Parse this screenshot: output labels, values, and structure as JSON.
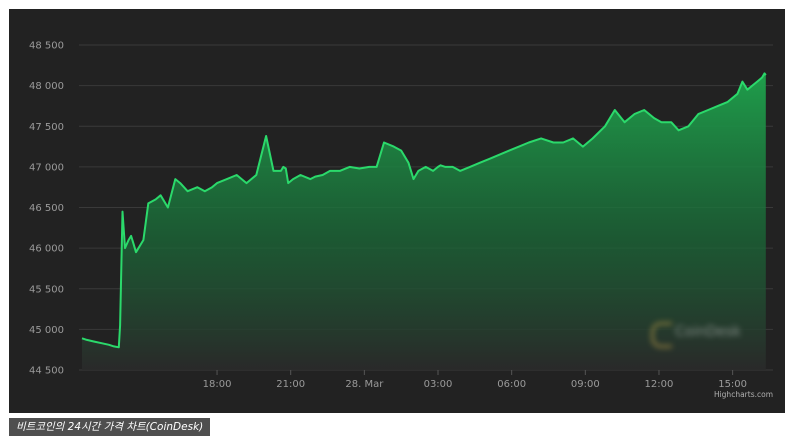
{
  "caption": "비트코인의 24시간 가격 차트(CoinDesk)",
  "credit": "Highcharts.com",
  "watermark": "CoinDesk",
  "colors": {
    "background": "#222222",
    "line": "#2bd96b",
    "area_top": "#1f9e4b",
    "area_bottom": "#2a2a2a",
    "grid": "#3a3a3a"
  },
  "chart_data": {
    "type": "area",
    "title": "",
    "xlabel": "",
    "ylabel": "",
    "ylim": [
      44500,
      48500
    ],
    "yticks": [
      "44 500",
      "45 000",
      "45 500",
      "46 000",
      "46 500",
      "47 000",
      "47 500",
      "48 000",
      "48 500"
    ],
    "ytick_values": [
      44500,
      45000,
      45500,
      46000,
      46500,
      47000,
      47500,
      48000,
      48500
    ],
    "xticks": [
      "18:00",
      "21:00",
      "28. Mar",
      "03:00",
      "06:00",
      "09:00",
      "12:00",
      "15:00"
    ],
    "xtick_hours": [
      3,
      6,
      9,
      12,
      15,
      18,
      21,
      24
    ],
    "xlim_hours": [
      -2.5,
      25.4
    ],
    "grid": true,
    "legend": "none",
    "series": [
      {
        "x": [
          -2.5,
          -2.3,
          -2.0,
          -1.7,
          -1.4,
          -1.2,
          -1.0,
          -0.95,
          -0.85,
          -0.75,
          -0.6,
          -0.5,
          -0.4,
          -0.3,
          -0.1,
          0.0,
          0.2,
          0.5,
          0.7,
          1.0,
          1.3,
          1.5,
          1.8,
          2.2,
          2.5,
          2.8,
          3.0,
          3.4,
          3.8,
          4.2,
          4.6,
          5.0,
          5.3,
          5.6,
          5.7,
          5.8,
          5.9,
          6.1,
          6.4,
          6.8,
          7.0,
          7.3,
          7.6,
          8.0,
          8.4,
          8.8,
          9.2,
          9.5,
          9.8,
          10.2,
          10.5,
          10.8,
          11.0,
          11.2,
          11.5,
          11.8,
          12.0,
          12.1,
          12.3,
          12.6,
          12.9,
          13.3,
          13.7,
          14.1,
          14.5,
          14.9,
          15.3,
          15.7,
          16.2,
          16.7,
          17.1,
          17.5,
          17.9,
          18.3,
          18.8,
          19.2,
          19.6,
          20.0,
          20.4,
          20.8,
          21.1,
          21.5,
          21.8,
          22.2,
          22.6,
          23.0,
          23.4,
          23.8,
          24.2,
          24.4,
          24.6,
          24.8,
          25.0,
          25.2,
          25.3,
          25.35
        ],
        "values": [
          44890,
          44870,
          44850,
          44830,
          44810,
          44790,
          44780,
          45050,
          46450,
          46000,
          46100,
          46150,
          46050,
          45950,
          46050,
          46100,
          46550,
          46600,
          46650,
          46500,
          46850,
          46800,
          46700,
          46750,
          46700,
          46750,
          46800,
          46850,
          46900,
          46800,
          46900,
          47380,
          46950,
          46950,
          47000,
          46980,
          46800,
          46850,
          46900,
          46850,
          46880,
          46900,
          46950,
          46950,
          47000,
          46980,
          47000,
          47000,
          47300,
          47250,
          47200,
          47050,
          46850,
          46950,
          47000,
          46950,
          47000,
          47020,
          47000,
          47000,
          46950,
          47000,
          47050,
          47100,
          47150,
          47200,
          47250,
          47300,
          47350,
          47300,
          47300,
          47350,
          47250,
          47350,
          47500,
          47700,
          47550,
          47650,
          47700,
          47600,
          47550,
          47550,
          47450,
          47500,
          47650,
          47700,
          47750,
          47800,
          47900,
          48050,
          47950,
          48000,
          48050,
          48100,
          48150,
          48130
        ]
      }
    ]
  }
}
